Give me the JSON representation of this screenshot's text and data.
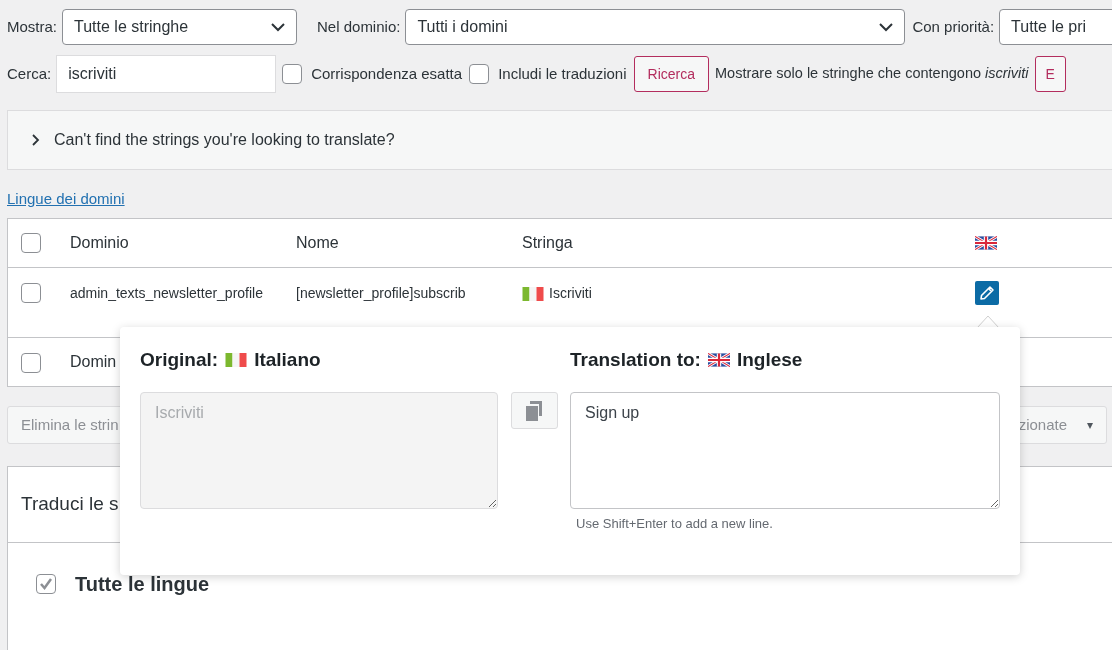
{
  "filters": [
    {
      "label": "Mostra:",
      "value": "Tutte le stringhe"
    },
    {
      "label": "Nel dominio:",
      "value": "Tutti i domini"
    },
    {
      "label": "Con priorità:",
      "value": "Tutte le pri"
    }
  ],
  "search": {
    "label": "Cerca:",
    "value": "iscriviti"
  },
  "options": [
    {
      "label": "Corrispondenza esatta",
      "checked": false
    },
    {
      "label": "Includi le traduzioni",
      "checked": false
    }
  ],
  "search_button": "Ricerca",
  "filter_note": "Mostrare solo le stringhe che contengono *iscriviti*",
  "cut_button": "E",
  "help_panel": {
    "text": "Can't find the strings you're looking to translate?",
    "expanded": false
  },
  "domain_languages_link": "Lingue dei domini",
  "table": {
    "all_selected": false,
    "columns": [
      "Dominio",
      "Nome",
      "Stringa"
    ],
    "rows": [
      {
        "selected": false,
        "domain": "admin_texts_newsletter_profile",
        "name": "[newsletter_profile]subscrib",
        "string": "Iscriviti"
      },
      {
        "selected": false,
        "domain": "Domin"
      }
    ]
  },
  "bulk_bar": {
    "action": "Elimina le strin",
    "right_select": "zionate",
    "caret": "▾"
  },
  "translate_section": {
    "title": "Traduci le s",
    "all_languages": {
      "label": "Tutte le lingue",
      "checked": true
    }
  },
  "popup": {
    "original_label": "Original:",
    "original_language": "Italiano",
    "translation_label": "Translation to:",
    "translation_language": "Inglese",
    "original_text": "Iscriviti",
    "translation_text": "Sign up",
    "hint": "Use Shift+Enter to add a new line."
  }
}
